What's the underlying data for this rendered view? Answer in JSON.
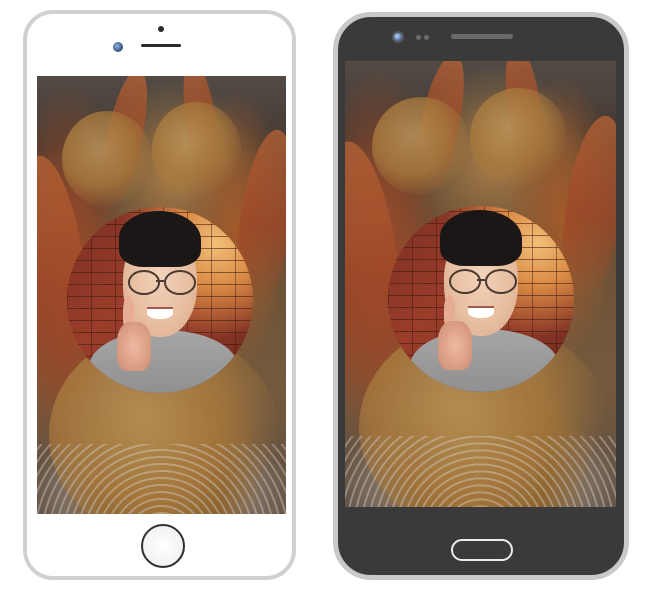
{
  "devices": [
    {
      "model": "iphone",
      "frame_color": "#d0d0d0",
      "body_color": "#ffffff",
      "screen_content": "food-photo-with-circular-avatar"
    },
    {
      "model": "android",
      "frame_color": "#c9c9c9",
      "body_color": "#3a3a3a",
      "screen_content": "food-photo-with-circular-avatar"
    }
  ],
  "icons": {
    "front_camera": "camera-lens-icon",
    "home_button": "home-button-icon"
  }
}
